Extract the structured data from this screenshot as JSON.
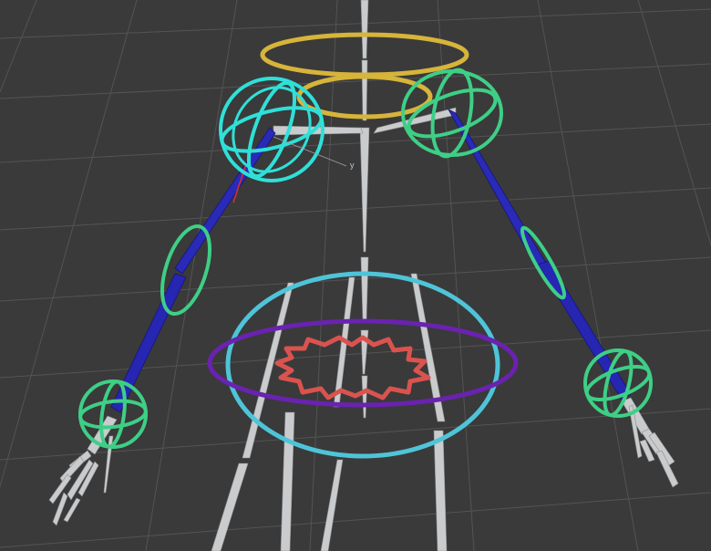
{
  "viewport": {
    "gizmo_axis_label": "y",
    "colors": {
      "background": "#3a3a3a",
      "grid": "#555555",
      "bone": "#c9cbcd",
      "bone_selected_arm": "#2424b8",
      "control_green": "#3ecf86",
      "control_selected_cyan": "#2fe0d8",
      "control_yellow": "#d7b43a",
      "control_cyan": "#4fc4d8",
      "control_purple": "#7a2bc0",
      "control_red": "#d9534f",
      "gizmo_x": "#d23030"
    }
  }
}
